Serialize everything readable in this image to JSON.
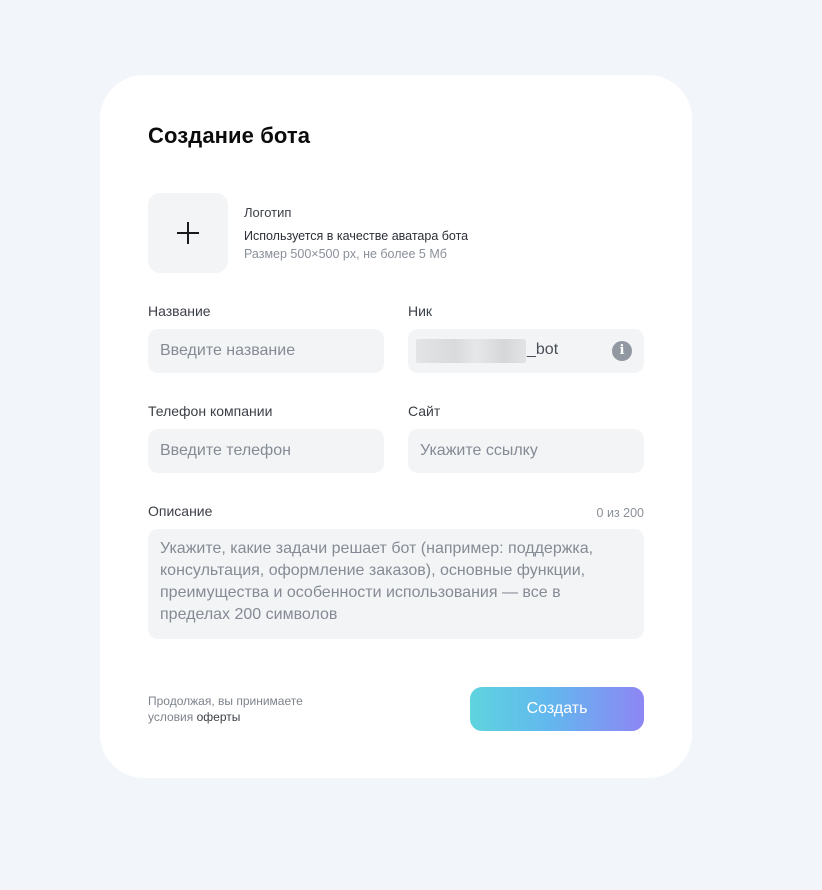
{
  "form": {
    "title": "Создание бота",
    "logo": {
      "icon": "plus-icon",
      "title": "Логотип",
      "description": "Используется в качестве аватара бота",
      "hint": "Размер 500×500 px, не более 5 Мб"
    },
    "name": {
      "label": "Название",
      "placeholder": "Введите название"
    },
    "nick": {
      "label": "Ник",
      "suffix": "_bot",
      "info_icon": "info-icon",
      "info_glyph": "i"
    },
    "phone": {
      "label": "Телефон компании",
      "placeholder": "Введите телефон"
    },
    "site": {
      "label": "Сайт",
      "placeholder": "Укажите ссылку"
    },
    "description": {
      "label": "Описание",
      "counter": "0 из 200",
      "placeholder": "Укажите, какие задачи решает бот (например: поддержка, консультация, оформление заказов), основные функции, преимущества и особенности использования — все в пределах 200 символов"
    },
    "terms": {
      "prefix": "Продолжая, вы принимаете",
      "prefix2": "условия",
      "link": "оферты"
    },
    "submit_label": "Создать",
    "colors": {
      "background": "#f2f5f9",
      "field": "#f3f4f6",
      "button_gradient_start": "#5fd4df",
      "button_gradient_end": "#8e86f4"
    }
  }
}
